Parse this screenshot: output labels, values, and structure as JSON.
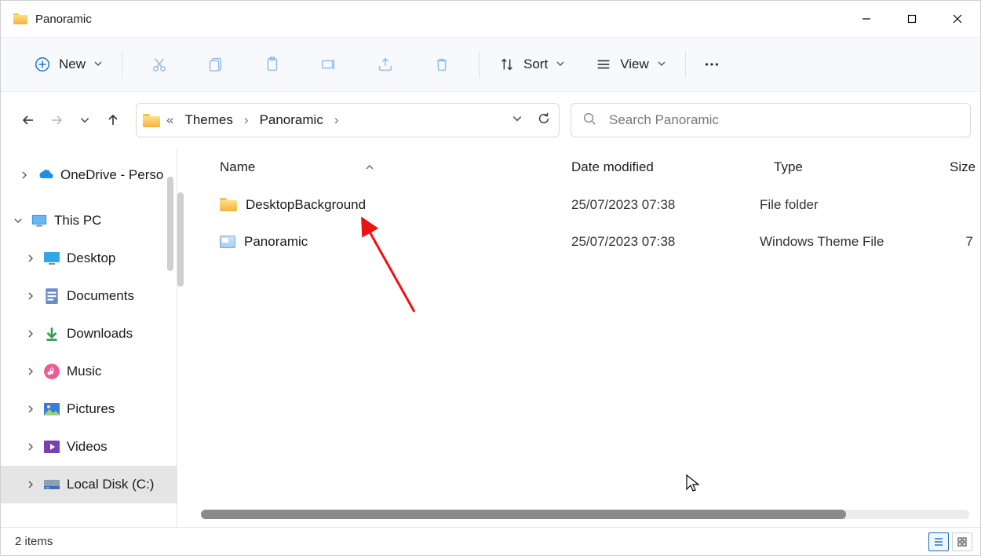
{
  "window": {
    "title": "Panoramic"
  },
  "toolbar": {
    "new_label": "New",
    "sort_label": "Sort",
    "view_label": "View"
  },
  "breadcrumbs": {
    "parent": "Themes",
    "current": "Panoramic"
  },
  "search": {
    "placeholder": "Search Panoramic"
  },
  "sidebar": {
    "onedrive": "OneDrive - Perso",
    "thispc": "This PC",
    "items": [
      {
        "label": "Desktop"
      },
      {
        "label": "Documents"
      },
      {
        "label": "Downloads"
      },
      {
        "label": "Music"
      },
      {
        "label": "Pictures"
      },
      {
        "label": "Videos"
      },
      {
        "label": "Local Disk (C:)"
      }
    ]
  },
  "columns": {
    "name": "Name",
    "date": "Date modified",
    "type": "Type",
    "size": "Size"
  },
  "rows": [
    {
      "name": "DesktopBackground",
      "date": "25/07/2023 07:38",
      "type": "File folder",
      "size": "",
      "icon": "folder"
    },
    {
      "name": "Panoramic",
      "date": "25/07/2023 07:38",
      "type": "Windows Theme File",
      "size": "7",
      "icon": "theme"
    }
  ],
  "status": {
    "text": "2 items"
  }
}
